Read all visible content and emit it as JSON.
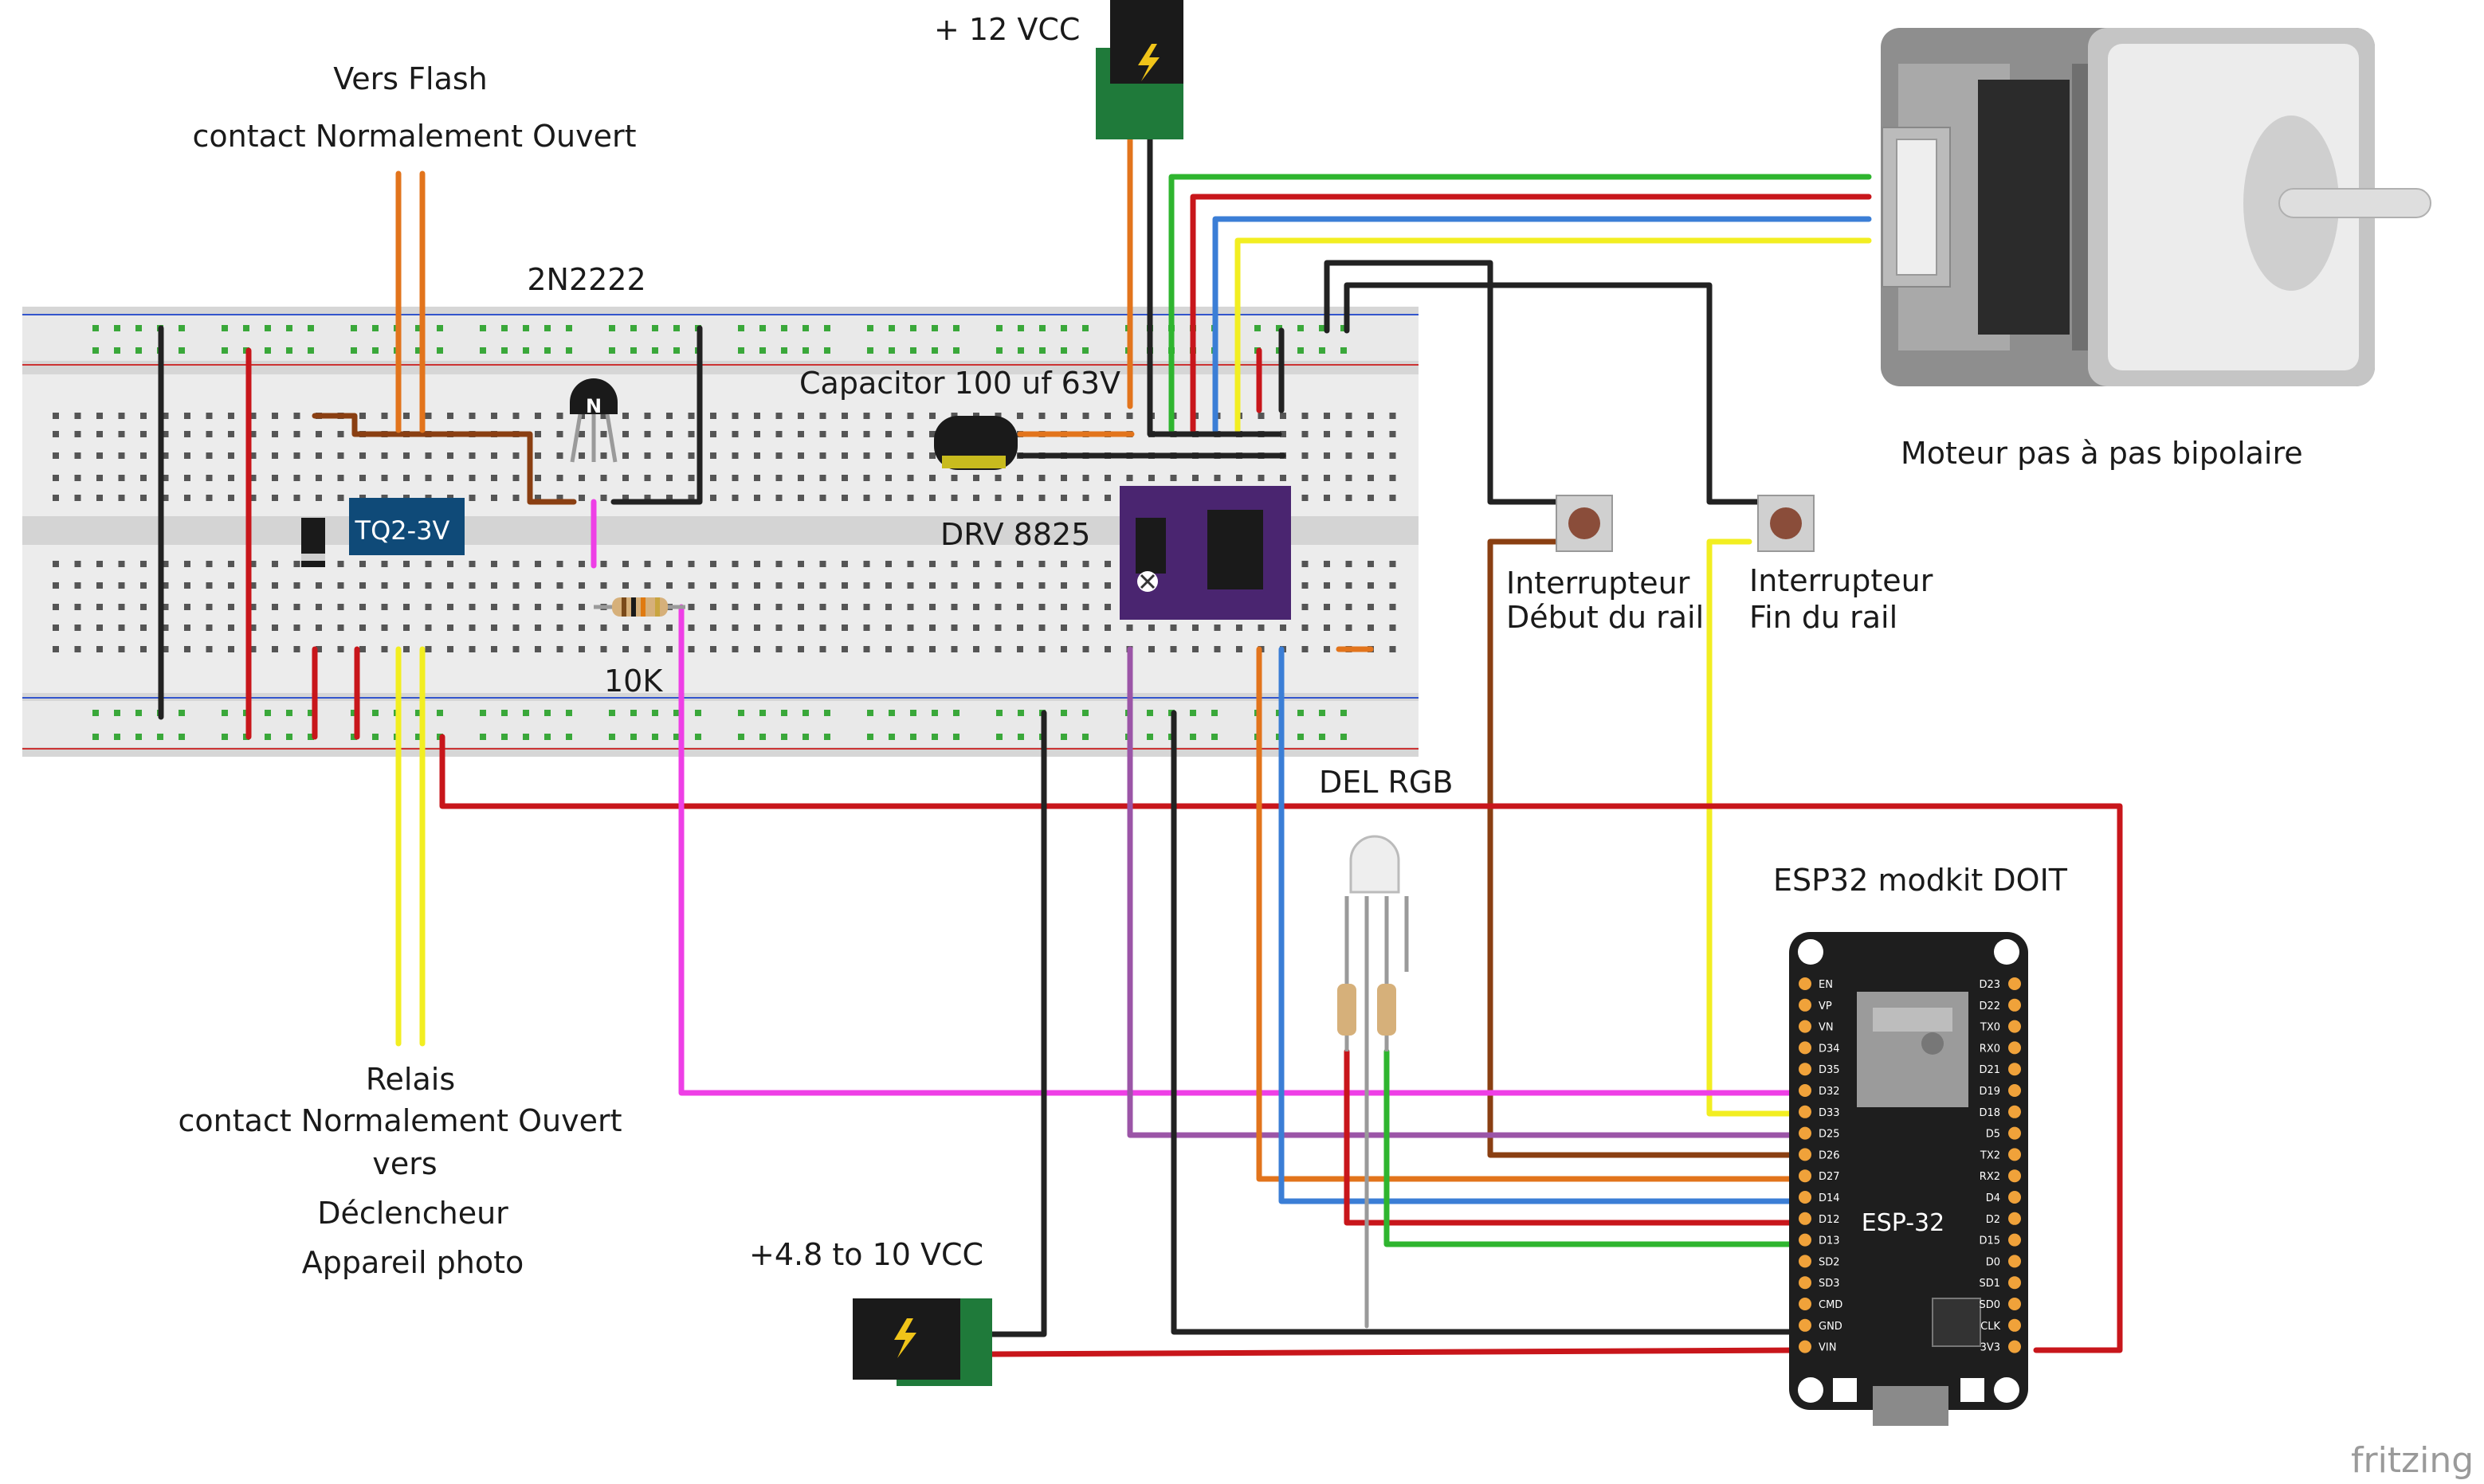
{
  "labels": {
    "vcc12": "+ 12 VCC",
    "vers_flash": "Vers Flash",
    "flash_contact": "contact Normalement Ouvert",
    "transistor": "2N2222",
    "capacitor": "Capacitor 100 uf 63V",
    "relay_chip": "TQ2-3V",
    "driver": "DRV 8825",
    "resistor": "10K",
    "motor": "Moteur pas à pas bipolaire",
    "switch_start_1": "Interrupteur",
    "switch_start_2": "Début du rail",
    "switch_end_1": "Interrupteur",
    "switch_end_2": "Fin du rail",
    "led": "DEL RGB",
    "esp_title": "ESP32 modkit DOIT",
    "esp_chip": "ESP-32",
    "relay_1": "Relais",
    "relay_2": "contact Normalement Ouvert",
    "relay_3": "vers",
    "relay_4": "Déclencheur",
    "relay_5": "Appareil photo",
    "vcc_low": "+4.8  to 10 VCC",
    "brand": "fritzing"
  },
  "esp_pins_left": [
    "EN",
    "VP",
    "VN",
    "D34",
    "D35",
    "D32",
    "D33",
    "D25",
    "D26",
    "D27",
    "D14",
    "D12",
    "D13",
    "SD2",
    "SD3",
    "CMD",
    "GND",
    "VIN"
  ],
  "esp_pins_right": [
    "D23",
    "D22",
    "TX0",
    "RX0",
    "D21",
    "D19",
    "D18",
    "D5",
    "TX2",
    "RX2",
    "D4",
    "D2",
    "D15",
    "D0",
    "SD1",
    "SD0",
    "CLK",
    "3V3"
  ],
  "colors": {
    "red": "#c8161b",
    "black": "#222222",
    "green": "#2fb52f",
    "blue": "#3b7ed6",
    "yellow": "#f2ee21",
    "orange": "#e2741c",
    "magenta": "#ee3fe6",
    "purple": "#9b55a7",
    "brown": "#8a3f12",
    "gray": "#9a9a9a"
  }
}
